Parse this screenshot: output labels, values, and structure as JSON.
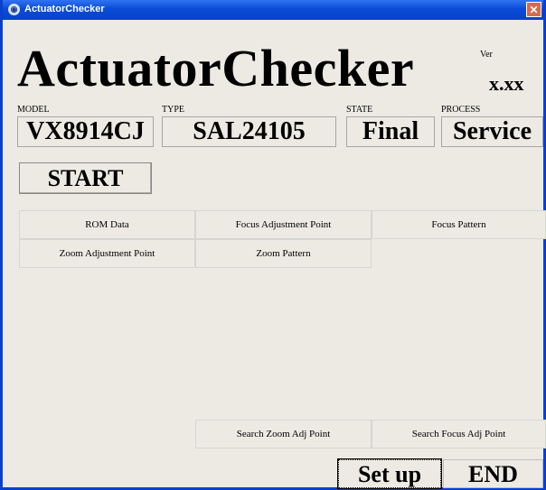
{
  "window": {
    "title": "ActuatorChecker",
    "close_glyph": "✕"
  },
  "header": {
    "app_title": "ActuatorChecker",
    "version_label": "Ver",
    "version_value": "x.xx"
  },
  "fields": {
    "model_label": "MODEL",
    "model_value": "VX8914CJ",
    "type_label": "TYPE",
    "type_value": "SAL24105",
    "state_label": "STATE",
    "state_value": "Final",
    "process_label": "PROCESS",
    "process_value": "Service"
  },
  "buttons": {
    "start": "START",
    "setup": "Set up",
    "end": "END"
  },
  "data_buttons": [
    "ROM Data",
    "Focus Adjustment Point",
    "Focus Pattern",
    "Zoom Adjustment Point",
    "Zoom Pattern"
  ],
  "search_buttons": [
    "Search Zoom Adj Point",
    "Search Focus Adj Point"
  ]
}
